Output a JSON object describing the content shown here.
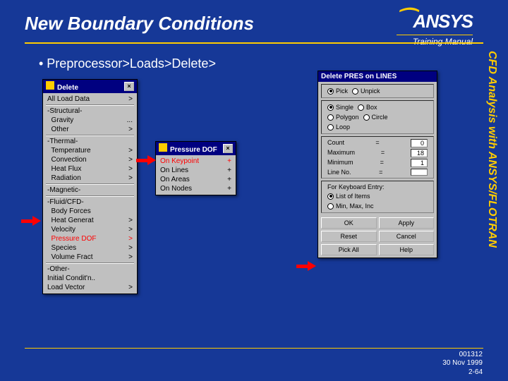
{
  "slide": {
    "title": "New Boundary Conditions",
    "bullet": "•  Preprocessor>Loads>Delete>",
    "logo": "ANSYS",
    "logo_sub": "Training Manual",
    "side": "CFD Analysis with ANSYS/FLOTRAN"
  },
  "delete_menu": {
    "title": "Delete",
    "items": [
      {
        "label": "All Load Data",
        "sym": ">",
        "hl": false,
        "sep_after": true
      },
      {
        "label": "-Structural-",
        "sym": "",
        "hl": false
      },
      {
        "label": "  Gravity",
        "sym": "...",
        "hl": false
      },
      {
        "label": "  Other",
        "sym": ">",
        "hl": false,
        "sep_after": true
      },
      {
        "label": "-Thermal-",
        "sym": "",
        "hl": false
      },
      {
        "label": "  Temperature",
        "sym": ">",
        "hl": false
      },
      {
        "label": "  Convection",
        "sym": ">",
        "hl": false
      },
      {
        "label": "  Heat Flux",
        "sym": ">",
        "hl": false
      },
      {
        "label": "  Radiation",
        "sym": ">",
        "hl": false,
        "sep_after": true
      },
      {
        "label": "-Magnetic-",
        "sym": "",
        "hl": false,
        "sep_after": true
      },
      {
        "label": "-Fluid/CFD-",
        "sym": "",
        "hl": false
      },
      {
        "label": "  Body Forces",
        "sym": "",
        "hl": false
      },
      {
        "label": "  Heat Generat",
        "sym": ">",
        "hl": false
      },
      {
        "label": "  Velocity",
        "sym": ">",
        "hl": false
      },
      {
        "label": "  Pressure DOF",
        "sym": ">",
        "hl": true
      },
      {
        "label": "  Species",
        "sym": ">",
        "hl": false
      },
      {
        "label": "  Volume Fract",
        "sym": ">",
        "hl": false,
        "sep_after": true
      },
      {
        "label": "-Other-",
        "sym": "",
        "hl": false
      },
      {
        "label": "Initial Condit'n..",
        "sym": "",
        "hl": false
      },
      {
        "label": "Load Vector",
        "sym": ">",
        "hl": false
      }
    ]
  },
  "pres_menu": {
    "title": "Pressure DOF",
    "items": [
      {
        "label": "On Keypoint",
        "sym": "+",
        "hl": true
      },
      {
        "label": "On Lines",
        "sym": "+",
        "hl": false
      },
      {
        "label": "On Areas",
        "sym": "+",
        "hl": false
      },
      {
        "label": "On Nodes",
        "sym": "+",
        "hl": false
      }
    ]
  },
  "lines_dialog": {
    "title": "Delete PRES on LINES",
    "group1": [
      {
        "label": "Pick",
        "sel": true
      },
      {
        "label": "Unpick",
        "sel": false
      }
    ],
    "group2": [
      {
        "label": "Single",
        "sel": true
      },
      {
        "label": "Box",
        "sel": false
      },
      {
        "label": "Polygon",
        "sel": false
      },
      {
        "label": "Circle",
        "sel": false
      },
      {
        "label": "Loop",
        "sel": false
      }
    ],
    "fields": [
      {
        "label": "Count",
        "op": "=",
        "val": "0"
      },
      {
        "label": "Maximum",
        "op": "=",
        "val": "18"
      },
      {
        "label": "Minimum",
        "op": "=",
        "val": "1"
      },
      {
        "label": "Line No.",
        "op": "=",
        "val": ""
      }
    ],
    "kbd_label": "For Keyboard Entry:",
    "kbd_opts": [
      {
        "label": "List of Items",
        "sel": true
      },
      {
        "label": "Min, Max, Inc",
        "sel": false
      }
    ],
    "buttons": [
      "OK",
      "Apply",
      "Reset",
      "Cancel",
      "Pick All",
      "Help"
    ]
  },
  "footer": {
    "id": "001312",
    "date": "30 Nov 1999",
    "page": "2-64"
  }
}
